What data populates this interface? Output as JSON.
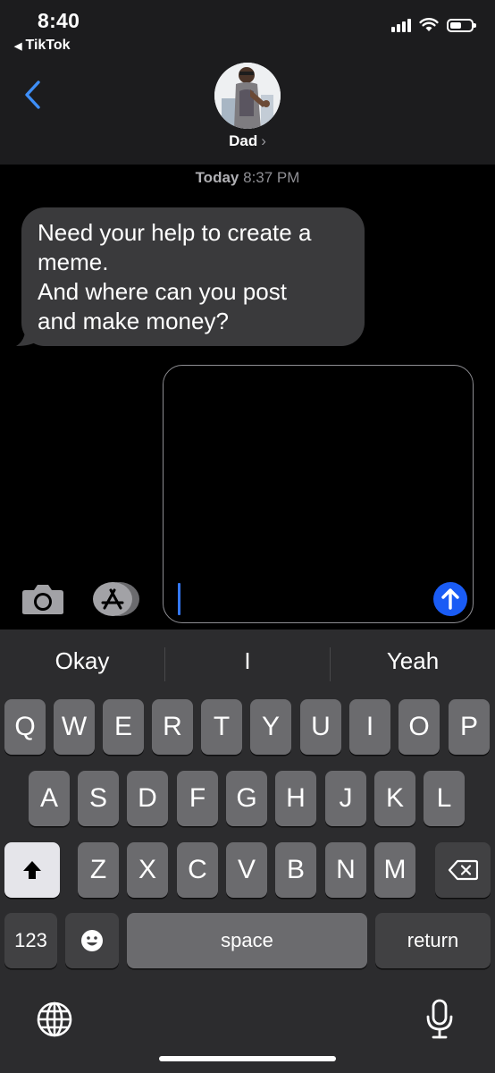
{
  "status_bar": {
    "time": "8:40",
    "back_app": "TikTok",
    "back_arrow": "◀",
    "battery_level_pct": 55,
    "signal_bars": 4
  },
  "header": {
    "contact_name": "Dad",
    "contact_chevron": "›",
    "back_icon": "chevron-left-icon"
  },
  "conversation": {
    "timestamp_day": "Today",
    "timestamp_time": "8:37 PM",
    "messages": [
      {
        "direction": "incoming",
        "lines": [
          "Need your help to create a",
          "meme.",
          "And where can you post",
          "and make money?"
        ]
      }
    ]
  },
  "compose": {
    "value": "",
    "camera_icon": "camera-icon",
    "apps_icon": "app-store-icon",
    "send_icon": "arrow-up-icon"
  },
  "keyboard": {
    "suggestions": [
      "Okay",
      "I",
      "Yeah"
    ],
    "row1": [
      "Q",
      "W",
      "E",
      "R",
      "T",
      "Y",
      "U",
      "I",
      "O",
      "P"
    ],
    "row2": [
      "A",
      "S",
      "D",
      "F",
      "G",
      "H",
      "J",
      "K",
      "L"
    ],
    "row3": [
      "Z",
      "X",
      "C",
      "V",
      "B",
      "N",
      "M"
    ],
    "numbers_label": "123",
    "space_label": "space",
    "return_label": "return",
    "shift_icon": "shift-icon",
    "delete_icon": "delete-icon",
    "emoji_icon": "emoji-icon",
    "globe_icon": "globe-icon",
    "mic_icon": "microphone-icon"
  },
  "colors": {
    "header_bg": "#1c1c1e",
    "incoming_bubble": "#3a3a3c",
    "accent_blue": "#1a5cf5",
    "key_bg": "#6b6b6e",
    "keyboard_bg": "#2c2c2e"
  }
}
